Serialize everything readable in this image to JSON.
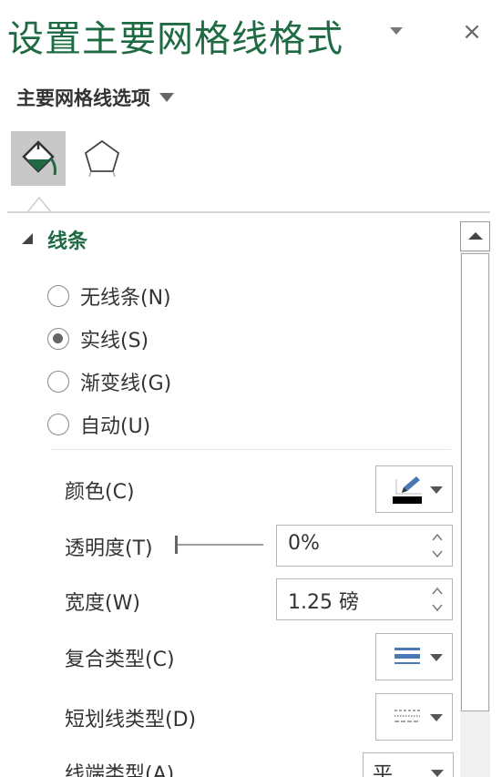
{
  "pane": {
    "title": "设置主要网格线格式",
    "close_glyph": "×"
  },
  "options_menu": {
    "label": "主要网格线选项"
  },
  "tabs": [
    {
      "name": "fill-line",
      "icon": "paint-bucket-icon",
      "active": true
    },
    {
      "name": "effects",
      "icon": "pentagon-icon",
      "active": false
    }
  ],
  "section": {
    "title": "线条",
    "expanded": true
  },
  "line_type": {
    "options": [
      {
        "label": "无线条(N)",
        "selected": false
      },
      {
        "label": "实线(S)",
        "selected": true
      },
      {
        "label": "渐变线(G)",
        "selected": false
      },
      {
        "label": "自动(U)",
        "selected": false
      }
    ]
  },
  "properties": {
    "color": {
      "label": "颜色(C)",
      "icon": "pen-color-icon",
      "swatch": "#000000"
    },
    "transparency": {
      "label": "透明度(T)",
      "value": "0%",
      "slider_fraction": 0
    },
    "width": {
      "label": "宽度(W)",
      "value": "1.25 磅"
    },
    "compound_type": {
      "label": "复合类型(C)",
      "icon": "compound-lines-icon"
    },
    "dash_type": {
      "label": "短划线类型(D)",
      "icon": "dash-lines-icon"
    },
    "cap_type": {
      "label": "线端类型(A)",
      "value": "平"
    }
  },
  "colors": {
    "accent_green": "#1e6b43",
    "icon_blue": "#4a78b5"
  }
}
